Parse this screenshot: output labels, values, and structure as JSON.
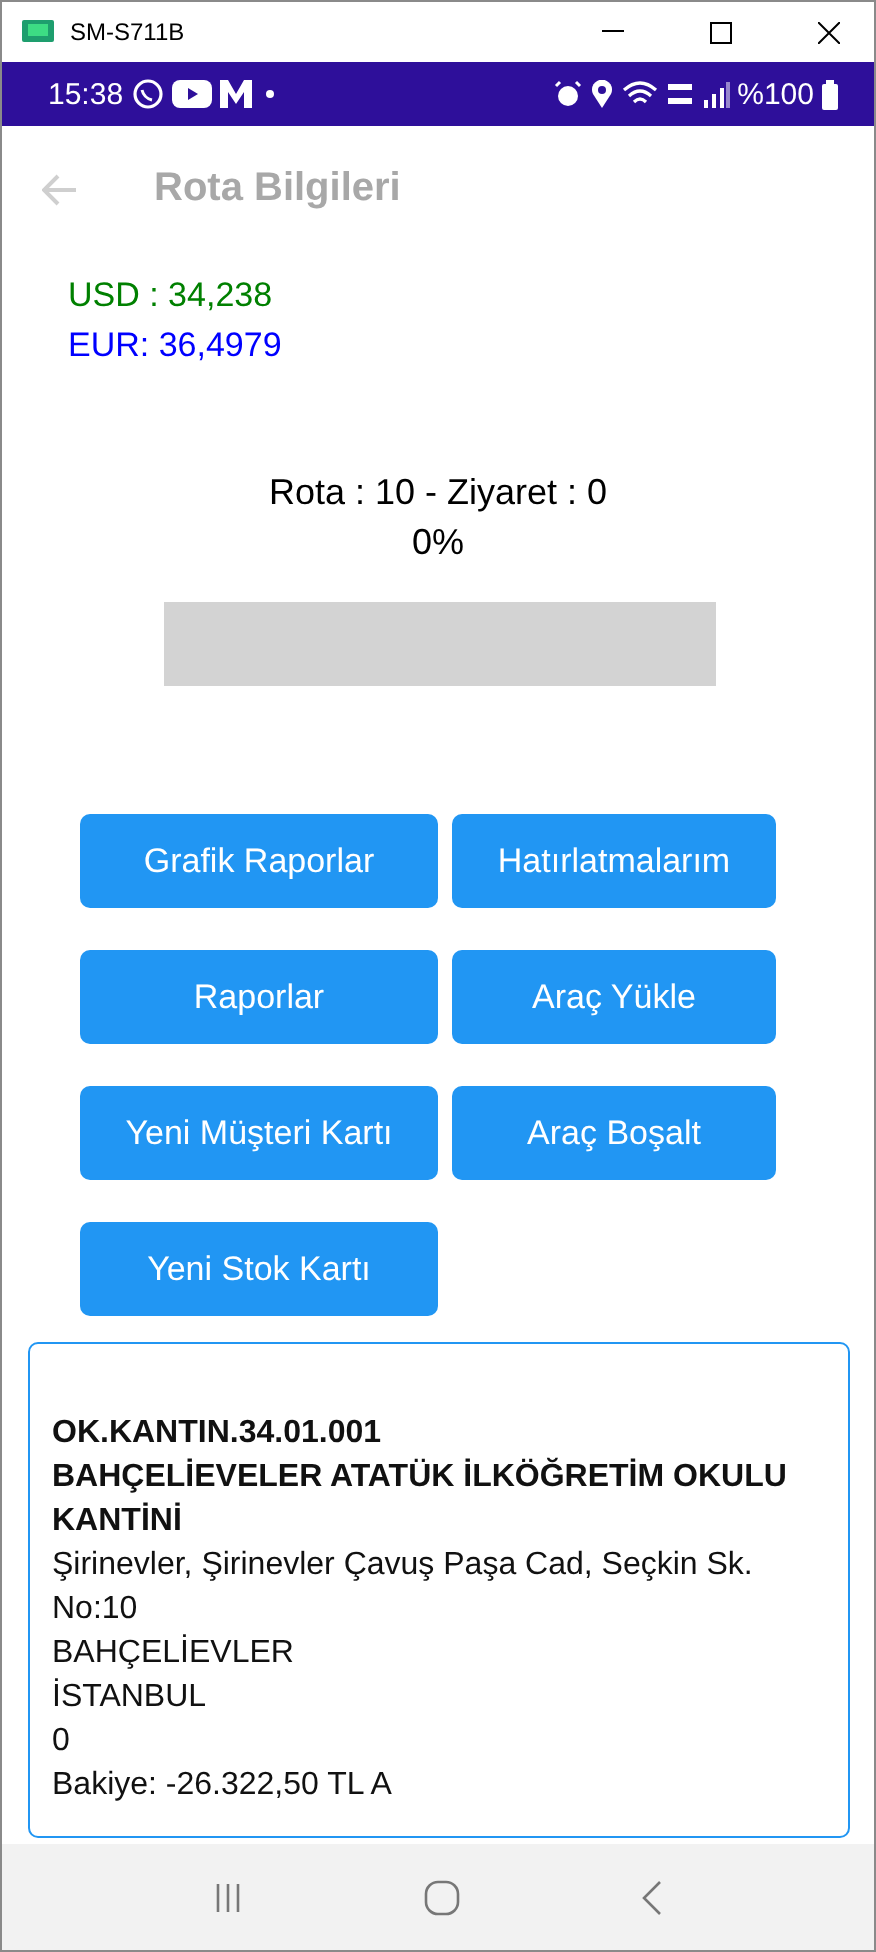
{
  "window": {
    "title": "SM-S711B"
  },
  "status_bar": {
    "time": "15:38",
    "battery": "%100"
  },
  "app_bar": {
    "title": "Rota Bilgileri"
  },
  "currencies": [
    {
      "text": "USD : 34,238",
      "color": "#008000"
    },
    {
      "text": "EUR: 36,4979",
      "color": "#0000ff"
    }
  ],
  "route": {
    "summary": "Rota : 10 - Ziyaret : 0",
    "percent": "0%",
    "level": 0
  },
  "buttons": [
    {
      "label": "Grafik Raporlar"
    },
    {
      "label": "Hatırlatmalarım"
    },
    {
      "label": "Raporlar"
    },
    {
      "label": "Araç Yükle"
    },
    {
      "label": "Yeni Müşteri Kartı"
    },
    {
      "label": "Araç Boşalt"
    },
    {
      "label": "Yeni Stok Kartı"
    }
  ],
  "customer": {
    "code": "OK.KANTIN.34.01.001",
    "name": "BAHÇELİEVELER ATATÜK İLKÖĞRETİM OKULU KANTİNİ",
    "address": "Şirinevler, Şirinevler Çavuş Paşa Cad, Seçkin Sk. No:10",
    "district": "BAHÇELİEVLER",
    "city": "İSTANBUL",
    "line_6": "0",
    "balance": "Bakiye: -26.322,50 TL A"
  }
}
